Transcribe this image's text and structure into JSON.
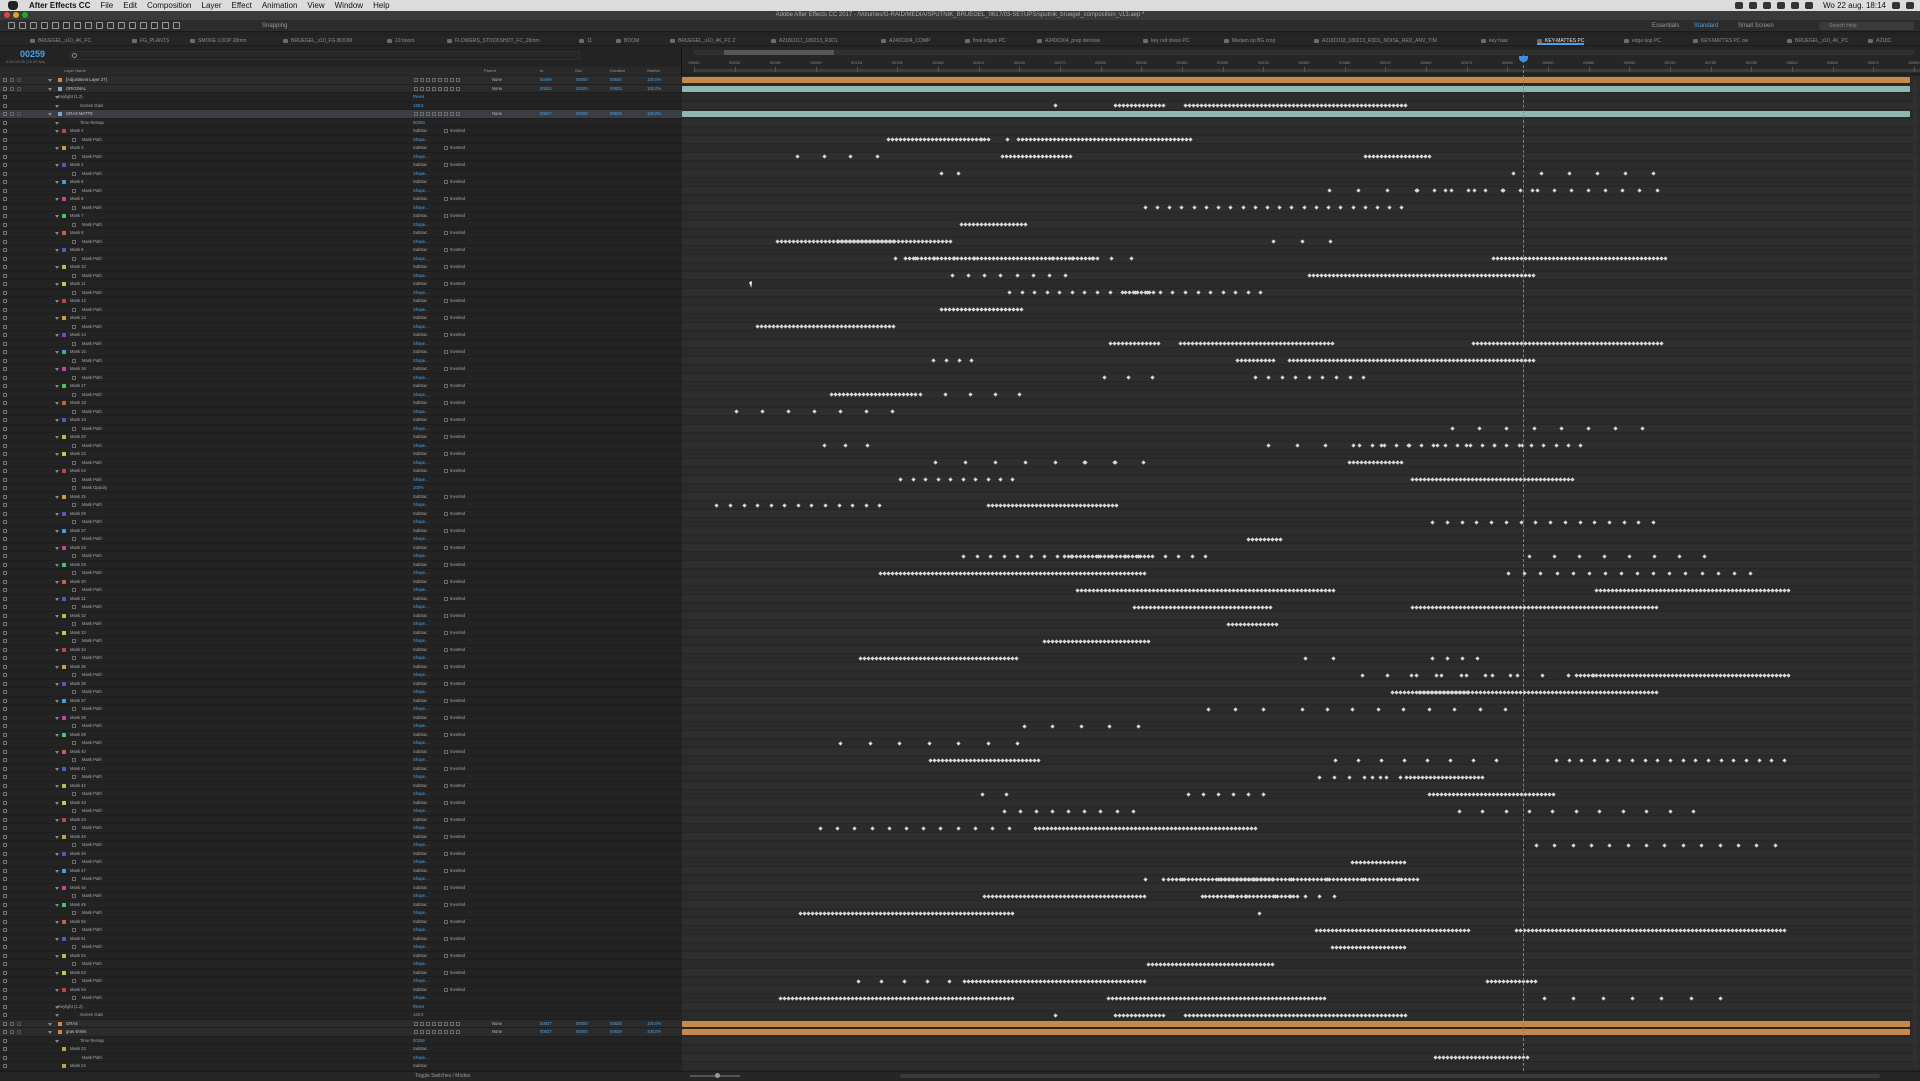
{
  "menubar": {
    "app": "After Effects CC",
    "items": [
      "File",
      "Edit",
      "Composition",
      "Layer",
      "Effect",
      "Animation",
      "View",
      "Window",
      "Help"
    ],
    "clock": "Wo 22 aug. 18:14"
  },
  "window_title": "Adobe After Effects CC 2017 - /Volumes/G-RAID/MEDIA/SPUTNIK_BRUEGEL_0617/03-SETUPS/sputnik_bruegel_composition_v13.aep *",
  "toolbar": {
    "snapping": "Snapping",
    "workspaces": [
      {
        "label": "Essentials",
        "active": false
      },
      {
        "label": "Standard",
        "active": true
      },
      {
        "label": "Small Screen",
        "active": false
      }
    ],
    "search_placeholder": "Search Help"
  },
  "tabs": [
    {
      "label": "BRUEGEL_v10_4K_FC",
      "active": false
    },
    {
      "label": "FG_PLANTS",
      "active": false
    },
    {
      "label": "SMOKE LOOP 28mm",
      "active": false
    },
    {
      "label": "BRUEGEL_v10_FG BOOM",
      "active": false
    },
    {
      "label": "10 boom",
      "active": false
    },
    {
      "label": "FLOWERS_STOCKSHOT_FC_28mm",
      "active": false
    },
    {
      "label": "11",
      "active": false
    },
    {
      "label": "BOOM",
      "active": false
    },
    {
      "label": "BRUEGEL_v10_4K_FC 2",
      "active": false
    },
    {
      "label": "A218C017_180213_R3D1",
      "active": false
    },
    {
      "label": "A240C004_COMP",
      "active": false
    },
    {
      "label": "final edges PC",
      "active": false
    },
    {
      "label": "A240C004_prep denoise",
      "active": false
    },
    {
      "label": "key red dress PC",
      "active": false
    },
    {
      "label": "Madam op BG crop",
      "active": false
    },
    {
      "label": "A218C018_180213_R3D1_NOISE_RED_ANV_TIM",
      "active": false
    },
    {
      "label": "key haar",
      "active": false
    },
    {
      "label": "KEY-MATTES PC",
      "active": true
    },
    {
      "label": "edge kop PC",
      "active": false
    },
    {
      "label": "KEY-MATTES PC ow",
      "active": false
    },
    {
      "label": "BRUEGEL_v10_4K_PC",
      "active": false
    },
    {
      "label": "A218C",
      "active": false
    }
  ],
  "timecode": "00259",
  "fps_info": "0:00:10:09 (25.00 fps)",
  "columns": {
    "layer_name": "Layer Name",
    "parent": "Parent",
    "in": "In",
    "out": "Out",
    "duration": "Duration",
    "stretch": "Stretch"
  },
  "ruler_ticks": [
    "00000",
    "00030",
    "00060",
    "00090",
    "00120",
    "00150",
    "00180",
    "00210",
    "00240",
    "00270",
    "00300",
    "00330",
    "00360",
    "00390",
    "00420",
    "00450",
    "00480",
    "00510",
    "00540",
    "00570",
    "00600",
    "00630",
    "00660",
    "00690",
    "00720",
    "00750",
    "00780",
    "00810",
    "00840",
    "00870",
    "00900"
  ],
  "layers_top": [
    {
      "name": "[Adjustment Layer 27]",
      "type": "layer",
      "parent": "None",
      "in": "00499",
      "out": "00000",
      "dur": "00500",
      "stretch": "100,0%",
      "bar": "orange"
    },
    {
      "name": "ORIGINAL",
      "type": "layer",
      "parent": "None",
      "in": "00824",
      "out": "00000",
      "dur": "00825",
      "stretch": "100,0%",
      "bar": "teal"
    },
    {
      "name": "Keylight (1.2)",
      "type": "effect",
      "value": "Reset"
    },
    {
      "name": "Screen Gain",
      "type": "prop",
      "value": "128,0"
    },
    {
      "name": "GRAS MATTE",
      "type": "layer",
      "parent": "None",
      "in": "00827",
      "out": "00000",
      "dur": "00828",
      "stretch": "100,0%",
      "bar": "teal",
      "selected": true
    },
    {
      "name": "Time Remap",
      "type": "prop",
      "value": "00259"
    }
  ],
  "masks": [
    "Mask 2",
    "Mask 3",
    "Mask 4",
    "Mask 5",
    "Mask 6",
    "Mask 7",
    "Mask 8",
    "Mask 9",
    "Mask 10",
    "Mask 11",
    "Mask 12",
    "Mask 13",
    "Mask 14",
    "Mask 15",
    "Mask 16",
    "Mask 17",
    "Mask 18",
    "Mask 19",
    "Mask 20",
    "Mask 22",
    "Mask 24",
    "Mask 25",
    "Mask 26",
    "Mask 27",
    "Mask 28",
    "Mask 29",
    "Mask 30",
    "Mask 31",
    "Mask 32",
    "Mask 33",
    "Mask 34",
    "Mask 35",
    "Mask 36",
    "Mask 37",
    "Mask 38",
    "Mask 39",
    "Mask 40",
    "Mask 41",
    "Mask 42",
    "Mask 43",
    "Mask 44",
    "Mask 45",
    "Mask 46",
    "Mask 47",
    "Mask 48",
    "Mask 49",
    "Mask 50",
    "Mask 51",
    "Mask 52",
    "Mask 53",
    "Mask 54"
  ],
  "mask_mode": "Subtrac",
  "mask_inverted": "Inverted",
  "mask_path_label": "Mask Path",
  "mask_opacity_label": "Mask Opacity",
  "mask_opacity_value": "100%",
  "shape_value": "Shape...",
  "layers_bottom": [
    {
      "name": "Keylight (1.2)",
      "type": "effect",
      "value": "Reset"
    },
    {
      "name": "Screen Gain",
      "type": "prop",
      "value": "128,0"
    },
    {
      "name": "GRAS",
      "type": "layer",
      "parent": "None",
      "in": "00827",
      "out": "00000",
      "dur": "00828",
      "stretch": "100,0%",
      "bar": "orange"
    },
    {
      "name": "gras shrink",
      "type": "layer",
      "parent": "None",
      "in": "00827",
      "out": "00000",
      "dur": "00828",
      "stretch": "100,0%",
      "bar": "orange"
    },
    {
      "name": "Time Remap",
      "type": "prop",
      "value": "00259"
    },
    {
      "name": "Mask 22",
      "type": "mask"
    },
    {
      "name": "Mask Path",
      "type": "maskpath"
    },
    {
      "name": "Mask 24",
      "type": "mask"
    }
  ],
  "bottom_bar": {
    "toggle_label": "Toggle Switches / Modes"
  },
  "colors": {
    "accent": "#4aa3e8",
    "orange_bar": "#c8894a",
    "teal_bar": "#8fb8b4",
    "label_colors": [
      "#c84040",
      "#c8a040",
      "#8040c8",
      "#40a0c8",
      "#c840a0",
      "#40c860",
      "#c86040",
      "#4060c8",
      "#a0c840",
      "#c8c840"
    ]
  }
}
